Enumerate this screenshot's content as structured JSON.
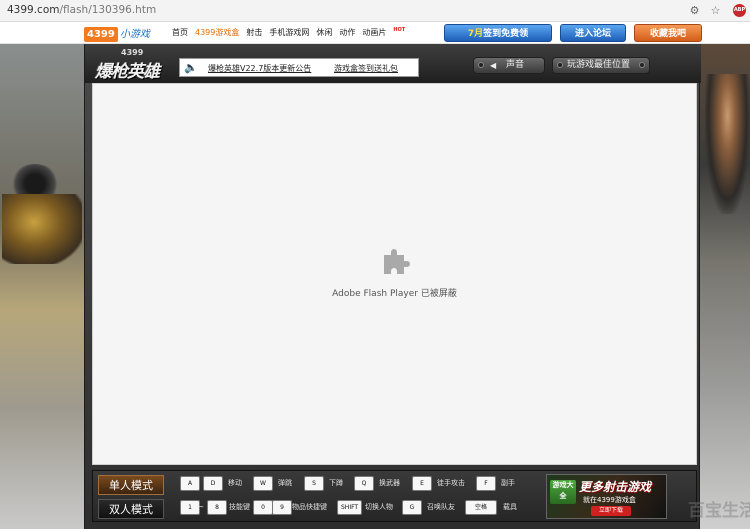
{
  "browser": {
    "url_host": "4399.com",
    "url_path": "/flash/130396.htm",
    "icons": [
      "translate-icon",
      "star-icon",
      "adblock-icon"
    ]
  },
  "site_nav": {
    "logo_num": "4399",
    "logo_text": "小游戏",
    "links": [
      {
        "label": "首页",
        "style": "normal"
      },
      {
        "label": "4399游戏盒",
        "style": "orange"
      },
      {
        "label": "射击",
        "style": "normal"
      },
      {
        "label": "手机游戏网",
        "style": "normal"
      },
      {
        "label": "休闲",
        "style": "normal"
      },
      {
        "label": "动作",
        "style": "normal"
      },
      {
        "label": "动画片",
        "style": "orange"
      }
    ],
    "hot_badge": "HOT",
    "checkin_month": "7月",
    "checkin_label": "签到免费领",
    "forum_label": "进入论坛",
    "favorite_label": "收藏我吧"
  },
  "game": {
    "logo_small": "4399",
    "logo_title": "爆枪英雄",
    "notice_1": "爆枪英雄V22.7版本更新公告",
    "notice_2": "游戏盒签到送礼包",
    "sound_label": "声音",
    "best_position_label": "玩游戏最佳位置",
    "flash_blocked_msg": "Adobe Flash Player 已被屏蔽"
  },
  "controls": {
    "single_mode": "单人模式",
    "double_mode": "双人模式",
    "row1": [
      {
        "keys": [
          "A",
          "D"
        ],
        "label": "移动"
      },
      {
        "keys": [
          "W"
        ],
        "label": "弹跳"
      },
      {
        "keys": [
          "S"
        ],
        "label": "下蹲"
      },
      {
        "keys": [
          "Q"
        ],
        "label": "换武器"
      },
      {
        "keys": [
          "E"
        ],
        "label": "徒手攻击"
      },
      {
        "keys": [
          "F"
        ],
        "label": "副手"
      }
    ],
    "row2": [
      {
        "keys": [
          "1",
          "8"
        ],
        "sep": "~",
        "label": "技能键"
      },
      {
        "keys": [
          "0",
          "9"
        ],
        "label": "物品快捷键"
      },
      {
        "keys": [
          "SHIFT"
        ],
        "label": "切换人物"
      },
      {
        "keys": [
          "G"
        ],
        "label": "召唤队友"
      },
      {
        "keys": [
          "空格"
        ],
        "label": "载具"
      }
    ]
  },
  "promo": {
    "tag": "游戏大全",
    "title": "更多射击游戏",
    "subtitle": "就在4399游戏盒",
    "download": "立即下载"
  },
  "watermark": "百宝生活"
}
